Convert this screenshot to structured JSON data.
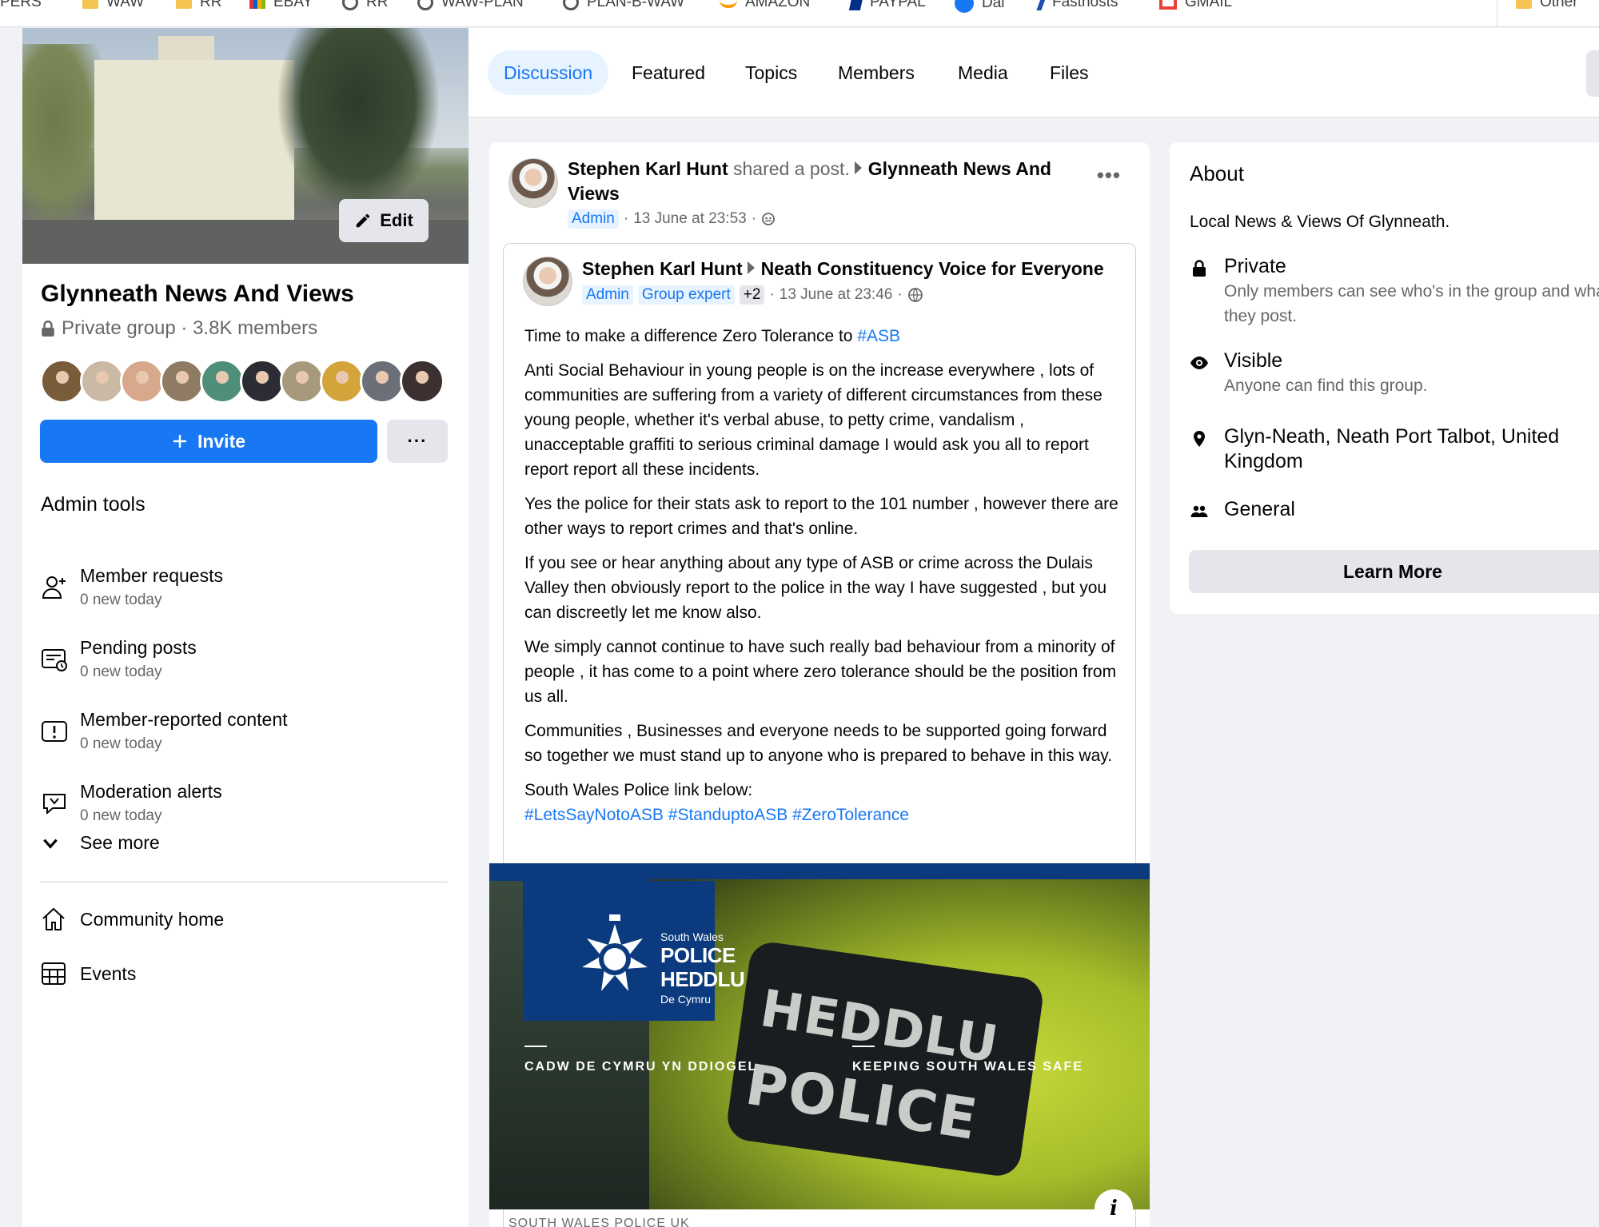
{
  "bookmarks": [
    {
      "label": "PERS",
      "icon": "folder-icon"
    },
    {
      "label": "WAW",
      "icon": "folder-icon"
    },
    {
      "label": "RR",
      "icon": "folder-icon"
    },
    {
      "label": "EBAY",
      "icon": "ebay-icon"
    },
    {
      "label": "RR",
      "icon": "globe-icon"
    },
    {
      "label": "WAW-PLAN",
      "icon": "globe-icon"
    },
    {
      "label": "PLAN-B-WAW",
      "icon": "globe-icon"
    },
    {
      "label": "AMAZON",
      "icon": "amazon-icon"
    },
    {
      "label": "PAYPAL",
      "icon": "paypal-icon"
    },
    {
      "label": "Dai",
      "icon": "facebook-icon"
    },
    {
      "label": "Fasthosts",
      "icon": "fasthosts-icon"
    },
    {
      "label": "GMAIL",
      "icon": "gmail-icon"
    },
    {
      "label": "Other",
      "icon": "folder-icon"
    }
  ],
  "sidebar": {
    "edit_label": "Edit",
    "group_name": "Glynneath News And Views",
    "group_meta": "Private group · 3.8K members",
    "invite_label": "Invite",
    "more_label": "···",
    "admin_title": "Admin tools",
    "tools": [
      {
        "title": "Member requests",
        "sub": "0 new today",
        "icon": "member-requests-icon"
      },
      {
        "title": "Pending posts",
        "sub": "0 new today",
        "icon": "pending-posts-icon"
      },
      {
        "title": "Member-reported content",
        "sub": "0 new today",
        "icon": "reported-content-icon"
      },
      {
        "title": "Moderation alerts",
        "sub": "0 new today",
        "icon": "moderation-alerts-icon"
      }
    ],
    "see_more": "See more",
    "nav": [
      {
        "label": "Community home",
        "icon": "home-icon"
      },
      {
        "label": "Events",
        "icon": "calendar-icon"
      }
    ],
    "member_avatar_colors": [
      "#7a5b3a",
      "#c9b9a5",
      "#d8a88c",
      "#8f7b64",
      "#4f8f7a",
      "#2c2c34",
      "#a79a7c",
      "#d2a43a",
      "#6b6f78",
      "#3c3030"
    ]
  },
  "tabs": [
    "Discussion",
    "Featured",
    "Topics",
    "Members",
    "Media",
    "Files"
  ],
  "active_tab": "Discussion",
  "post": {
    "author": "Stephen Karl Hunt",
    "action": "shared a post.",
    "group": "Glynneath News And Views",
    "role": "Admin",
    "time": "13 June at 23:53",
    "dots": "•••",
    "shared": {
      "author": "Stephen Karl Hunt",
      "group": "Neath Constituency Voice for Everyone",
      "badges": [
        "Admin",
        "Group expert",
        "+2"
      ],
      "time": "13 June at 23:46",
      "p1_text": "Time to make a difference Zero Tolerance to ",
      "p1_tag": "#ASB",
      "p2": "Anti Social Behaviour in young people is on the increase everywhere , lots of communities are suffering from a variety of different circumstances from these young people, whether it's verbal abuse, to petty crime, vandalism , unacceptable graffiti to serious criminal damage I would ask you all to report report report all these incidents.",
      "p3": "Yes the police for their stats ask to report to the 101 number , however there are other ways to report crimes and that's online.",
      "p4": "If you see or hear anything about any type of ASB or crime across the Dulais Valley then obviously report to the police in the way I have suggested , but you can discreetly let me know also.",
      "p5": "We simply cannot continue to have such really bad behaviour from a minority of people , it has come to a point where zero tolerance should be the position from us all.",
      "p6": "Communities , Businesses and everyone needs to be supported going forward so together we must stand up to anyone who is prepared to behave in this way.",
      "p7": "South Wales Police link below:",
      "tags": [
        "#LetsSayNotoASB",
        "#StanduptoASB",
        "#ZeroTolerance"
      ]
    },
    "image": {
      "logo_small": "South Wales",
      "logo_line1": "POLICE",
      "logo_line2": "HEDDLU",
      "logo_sub": "De Cymru",
      "patch_line1": "HEDDLU",
      "patch_line2": "POLICE",
      "tag_left": "CADW DE CYMRU YN DDIOGEL",
      "tag_right": "KEEPING SOUTH WALES SAFE"
    },
    "link_caption": "SOUTH WALES POLICE UK",
    "info_label": "i"
  },
  "about": {
    "title": "About",
    "description": "Local News & Views Of Glynneath.",
    "private_title": "Private",
    "private_sub": "Only members can see who's in the group and what they post.",
    "visible_title": "Visible",
    "visible_sub": "Anyone can find this group.",
    "location": "Glyn-Neath, Neath Port Talbot, United Kingdom",
    "category": "General",
    "learn_more": "Learn More"
  },
  "colors": {
    "accent": "#1877f2",
    "background": "#f0f2f5"
  }
}
